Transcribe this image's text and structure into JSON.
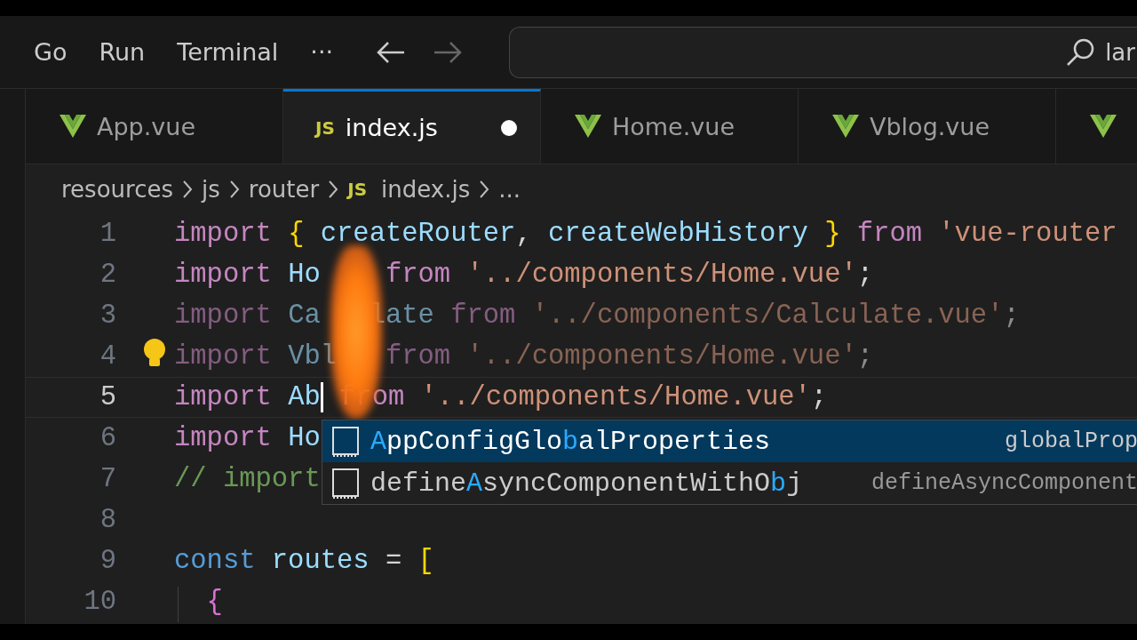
{
  "menu": {
    "items": [
      "Go",
      "Run",
      "Terminal"
    ],
    "more": "···"
  },
  "nav": {
    "back_enabled": true,
    "forward_enabled": false
  },
  "search": {
    "value": "lar"
  },
  "tabs": [
    {
      "label": "App.vue",
      "kind": "vue",
      "selected": false,
      "dirty": false
    },
    {
      "label": "index.js",
      "kind": "js",
      "badge": "JS",
      "selected": true,
      "dirty": true
    },
    {
      "label": "Home.vue",
      "kind": "vue",
      "selected": false,
      "dirty": false
    },
    {
      "label": "Vblog.vue",
      "kind": "vue",
      "selected": false,
      "dirty": false
    },
    {
      "kind": "vue",
      "selected": false
    }
  ],
  "breadcrumb": [
    {
      "label": "resources",
      "kind": "folder"
    },
    {
      "label": "js",
      "kind": "folder"
    },
    {
      "label": "router",
      "kind": "folder"
    },
    {
      "label": "index.js",
      "kind": "js",
      "badge": "JS"
    },
    {
      "label": "...",
      "kind": "more"
    }
  ],
  "code": {
    "lines": [
      {
        "number": "1",
        "faded": false,
        "current": false,
        "tokens": [
          {
            "text": "import",
            "kind": "kw"
          },
          {
            "text": " {",
            "kind": "brace"
          },
          {
            "text": " createRouter",
            "kind": "id"
          },
          {
            "text": ",",
            "kind": "punc"
          },
          {
            "text": " createWebHistory",
            "kind": "id"
          },
          {
            "text": " }",
            "kind": "brace"
          },
          {
            "text": " from",
            "kind": "kw"
          },
          {
            "text": " 'vue-router",
            "kind": "str"
          }
        ]
      },
      {
        "number": "2",
        "faded": false,
        "current": false,
        "tokens": [
          {
            "text": "import",
            "kind": "kw"
          },
          {
            "text": " Ho",
            "kind": "id"
          },
          {
            "text": "    from",
            "kind": "kw"
          },
          {
            "text": " '../components/Home.vue'",
            "kind": "str"
          },
          {
            "text": ";",
            "kind": "punc"
          }
        ]
      },
      {
        "number": "3",
        "faded": true,
        "current": false,
        "tokens": [
          {
            "text": "import",
            "kind": "kw"
          },
          {
            "text": " Ca",
            "kind": "id"
          },
          {
            "text": "   late",
            "kind": "id"
          },
          {
            "text": " from",
            "kind": "kw"
          },
          {
            "text": " '../components/Calculate.vue'",
            "kind": "str"
          },
          {
            "text": ";",
            "kind": "punc"
          }
        ]
      },
      {
        "number": "4",
        "faded": true,
        "current": false,
        "tokens": [
          {
            "text": "import",
            "kind": "kw"
          },
          {
            "text": " Vbl",
            "kind": "id"
          },
          {
            "text": "   from",
            "kind": "kw"
          },
          {
            "text": " '../components/Home.vue'",
            "kind": "str"
          },
          {
            "text": ";",
            "kind": "punc"
          }
        ]
      },
      {
        "number": "5",
        "faded": false,
        "current": true,
        "tokens": [
          {
            "text": "import",
            "kind": "kw"
          },
          {
            "text": " Ab",
            "kind": "id",
            "caret": true
          },
          {
            "text": " from",
            "kind": "kw"
          },
          {
            "text": " '../components/Home.vue'",
            "kind": "str"
          },
          {
            "text": ";",
            "kind": "punc"
          }
        ]
      },
      {
        "number": "6",
        "faded": false,
        "current": false,
        "tokens": [
          {
            "text": "import",
            "kind": "kw"
          },
          {
            "text": " Ho",
            "kind": "id"
          }
        ]
      },
      {
        "number": "7",
        "faded": false,
        "current": false,
        "tokens": [
          {
            "text": "// import",
            "kind": "comment"
          }
        ]
      },
      {
        "number": "8",
        "current": false
      },
      {
        "number": "9",
        "faded": false,
        "current": false,
        "tokens": [
          {
            "text": "const",
            "kind": "decl"
          },
          {
            "text": " routes",
            "kind": "id"
          },
          {
            "text": " =",
            "kind": "punc"
          },
          {
            "text": " [",
            "kind": "brace"
          }
        ]
      },
      {
        "number": "10",
        "faded": false,
        "current": false,
        "tokens": [
          {
            "text": "  {",
            "kind": "brace2"
          }
        ]
      }
    ]
  },
  "suggestions": [
    {
      "selected": true,
      "label": [
        {
          "text": "A",
          "match": true
        },
        {
          "text": "ppConfigGlo",
          "match": false
        },
        {
          "text": "b",
          "match": true
        },
        {
          "text": "alProperties",
          "match": false
        }
      ],
      "detail": "globalProp"
    },
    {
      "selected": false,
      "label": [
        {
          "text": "define",
          "match": false
        },
        {
          "text": "A",
          "match": true
        },
        {
          "text": "syncComponentWithO",
          "match": false
        },
        {
          "text": "b",
          "match": true
        },
        {
          "text": "j",
          "match": false
        }
      ],
      "detail": "defineAsyncComponent"
    }
  ]
}
